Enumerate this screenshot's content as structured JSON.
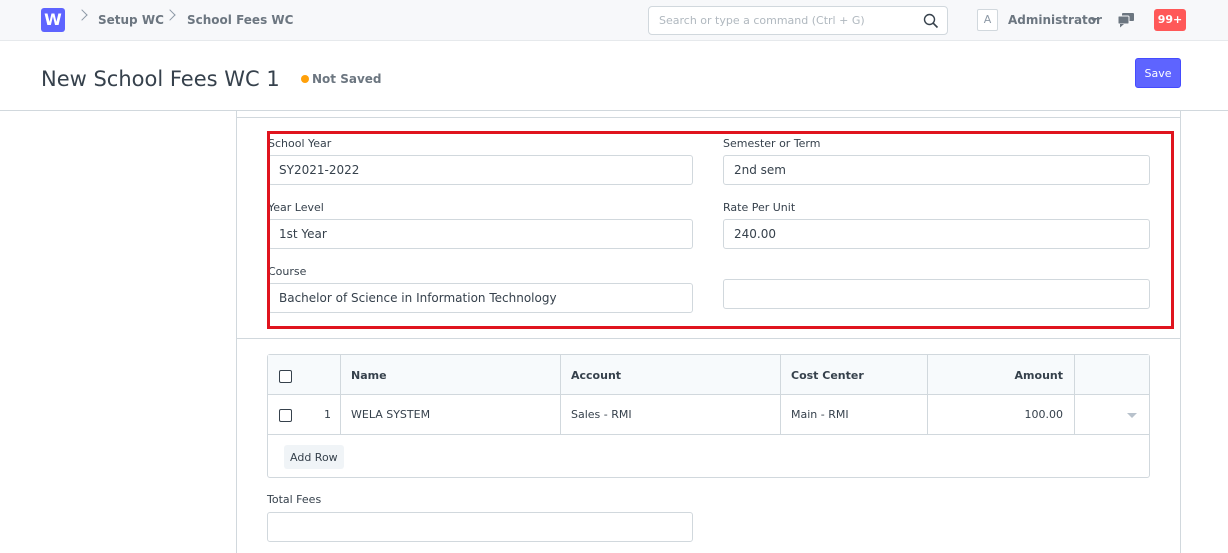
{
  "navbar": {
    "logo_letter": "W",
    "breadcrumbs": [
      "Setup WC",
      "School Fees WC"
    ],
    "search_placeholder": "Search or type a command (Ctrl + G)",
    "avatar_letter": "A",
    "user_name": "Administrator",
    "notification_count": "99+"
  },
  "page_head": {
    "title": "New School Fees WC 1",
    "status": "Not Saved",
    "status_color": "#ffa00a",
    "save_label": "Save",
    "accent_color": "#5e64ff"
  },
  "form": {
    "school_year": {
      "label": "School Year",
      "value": "SY2021-2022"
    },
    "semester": {
      "label": "Semester or Term",
      "value": "2nd sem"
    },
    "year_level": {
      "label": "Year Level",
      "value": "1st Year"
    },
    "rate_per_unit": {
      "label": "Rate Per Unit",
      "value": "240.00"
    },
    "course": {
      "label": "Course",
      "value": "Bachelor of Science in Information Technology"
    },
    "unlabeled_field": {
      "value": ""
    },
    "total_fees": {
      "label": "Total Fees",
      "value": ""
    }
  },
  "table": {
    "headers": {
      "name": "Name",
      "account": "Account",
      "cost_center": "Cost Center",
      "amount": "Amount"
    },
    "rows": [
      {
        "idx": "1",
        "name": "WELA SYSTEM",
        "account": "Sales - RMI",
        "cost_center": "Main - RMI",
        "amount": "100.00"
      }
    ],
    "add_row_label": "Add Row"
  },
  "highlight_color": "#e0141e"
}
